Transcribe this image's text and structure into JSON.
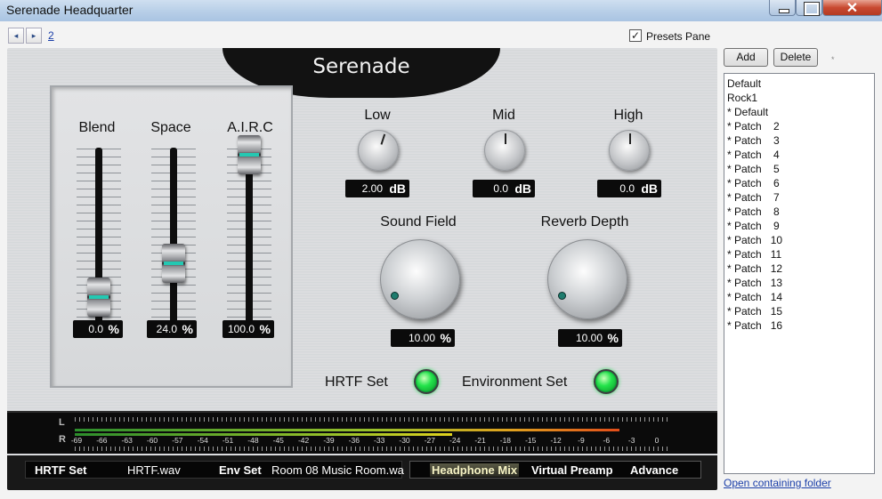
{
  "window": {
    "title": "Serenade Headquarter"
  },
  "nav": {
    "back": "◂",
    "forward": "▸",
    "page_link": "2"
  },
  "presets_pane": {
    "checked": true,
    "check_mark": "✓",
    "label": "Presets Pane"
  },
  "logo": "Serenade",
  "faders": [
    {
      "label": "Blend",
      "value": "0.0",
      "unit": "%",
      "level": 0.0
    },
    {
      "label": "Space",
      "value": "24.0",
      "unit": "%",
      "level": 0.24
    },
    {
      "label": "A.I.R.C",
      "value": "100.0",
      "unit": "%",
      "level": 1.0
    }
  ],
  "eq": [
    {
      "label": "Low",
      "value": "2.00",
      "unit": "dB"
    },
    {
      "label": "Mid",
      "value": "0.0",
      "unit": "dB"
    },
    {
      "label": "High",
      "value": "0.0",
      "unit": "dB"
    }
  ],
  "big_knobs": [
    {
      "label": "Sound Field",
      "value": "10.00",
      "unit": "%"
    },
    {
      "label": "Reverb Depth",
      "value": "10.00",
      "unit": "%"
    }
  ],
  "sets": {
    "hrtf_label": "HRTF Set",
    "env_label": "Environment Set"
  },
  "meter": {
    "left_label": "L",
    "right_label": "R",
    "scale": [
      "-69",
      "-66",
      "-63",
      "-60",
      "-57",
      "-54",
      "-51",
      "-48",
      "-45",
      "-42",
      "-39",
      "-36",
      "-33",
      "-30",
      "-27",
      "-24",
      "-21",
      "-18",
      "-15",
      "-12",
      "-9",
      "-6",
      "-3",
      "0"
    ]
  },
  "infobar": {
    "hrtf_set_label": "HRTF Set",
    "hrtf_file": "HRTF.wav",
    "env_set_label": "Env Set",
    "env_file": "Room 08 Music Room.wa",
    "tabs": [
      "Headphone Mix",
      "Virtual Preamp",
      "Advance"
    ]
  },
  "sidebar": {
    "add_label": "Add",
    "delete_label": "Delete",
    "star": "*",
    "presets": [
      "Default",
      "Rock1",
      "* Default",
      "* Patch    2",
      "* Patch    3",
      "* Patch    4",
      "* Patch    5",
      "* Patch    6",
      "* Patch    7",
      "* Patch    8",
      "* Patch    9",
      "* Patch   10",
      "* Patch   11",
      "* Patch   12",
      "* Patch   13",
      "* Patch   14",
      "* Patch   15",
      "* Patch   16"
    ],
    "open_folder_link": "Open containing folder"
  }
}
